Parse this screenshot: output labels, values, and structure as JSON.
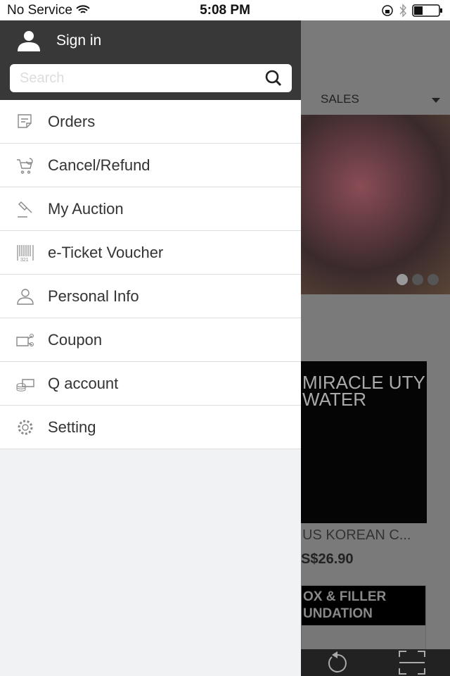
{
  "status": {
    "carrier": "No Service",
    "time": "5:08 PM"
  },
  "drawer": {
    "sign_in": "Sign in",
    "search_placeholder": "Search",
    "items": [
      {
        "label": "Orders",
        "icon": "receipt-icon"
      },
      {
        "label": "Cancel/Refund",
        "icon": "cart-refund-icon"
      },
      {
        "label": "My Auction",
        "icon": "gavel-icon"
      },
      {
        "label": "e-Ticket Voucher",
        "icon": "barcode-icon"
      },
      {
        "label": "Personal Info",
        "icon": "person-icon"
      },
      {
        "label": "Coupon",
        "icon": "coupon-icon"
      },
      {
        "label": "Q account",
        "icon": "money-icon"
      },
      {
        "label": "Setting",
        "icon": "gear-icon"
      }
    ]
  },
  "background": {
    "sort_label": "SALES",
    "product_title_art": "MIRACLE UTY WATER",
    "product_name": "US KOREAN C...",
    "product_price": "S$26.90",
    "product2_banner": "OX & FILLER UNDATION"
  }
}
